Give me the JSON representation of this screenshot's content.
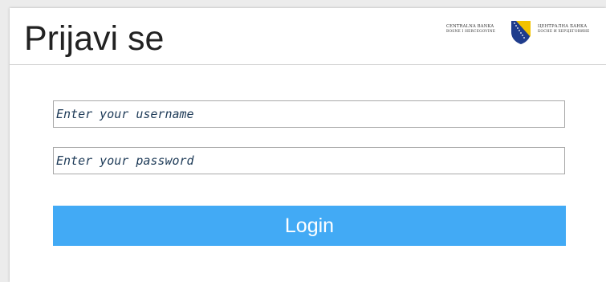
{
  "header": {
    "title": "Prijavi se",
    "logo": {
      "left_line1": "CENTRALNA BANKA",
      "left_line2": "BOSNE I HERCEGOVINE",
      "right_line1": "ЦЕНТРАЛНА БАНКА",
      "right_line2": "БОСНЕ И ХЕРЦЕГОВИНЕ",
      "shield_color": "#1f3c8c",
      "shield_accent": "#f2c200"
    }
  },
  "form": {
    "username_placeholder": "Enter your username",
    "password_placeholder": "Enter your password",
    "login_label": "Login"
  },
  "colors": {
    "accent": "#42aaf5",
    "input_text": "#1d3a57"
  }
}
